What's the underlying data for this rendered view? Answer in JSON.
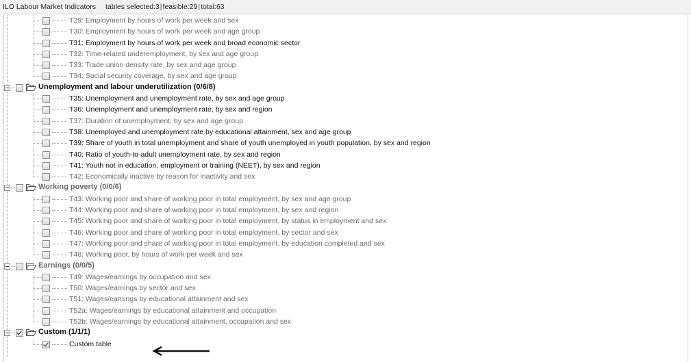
{
  "window": {
    "title": "ILO Labour Market Indicators",
    "status_prefix": "tables selected:3",
    "status_feasible": "feasible:29",
    "status_total": "total:63",
    "separator": "|"
  },
  "tree": {
    "rows": [
      {
        "kind": "leaf",
        "label": "T29: Employment by hours of work per week and sex",
        "enabled": false,
        "checked": false
      },
      {
        "kind": "leaf",
        "label": "T30: Employment by hours of work per week and age group",
        "enabled": false,
        "checked": false
      },
      {
        "kind": "leaf",
        "label": "T31: Employment by hours of work per week and broad economic sector",
        "enabled": true,
        "checked": false
      },
      {
        "kind": "leaf",
        "label": "T32: Time-related underemployment, by sex and age group",
        "enabled": false,
        "checked": false
      },
      {
        "kind": "leaf",
        "label": "T33: Trade union density rate, by sex and age group",
        "enabled": false,
        "checked": false
      },
      {
        "kind": "leaf",
        "label": "T34: Social security coverage, by sex and age group",
        "enabled": false,
        "checked": false
      },
      {
        "kind": "group",
        "label": "Unemployment and labour underutilization (0/6/8)",
        "enabled": true,
        "checked": false
      },
      {
        "kind": "leaf",
        "label": "T35: Unemployment and unemployment rate, by sex and age group",
        "enabled": true,
        "checked": false
      },
      {
        "kind": "leaf",
        "label": "T36: Unemployment and unemployment rate, by sex and region",
        "enabled": true,
        "checked": false
      },
      {
        "kind": "leaf",
        "label": "T37: Duration of unemployment, by sex and age group",
        "enabled": false,
        "checked": false
      },
      {
        "kind": "leaf",
        "label": "T38: Unemployed and unemployment rate by educational attainment, sex and age group",
        "enabled": true,
        "checked": false
      },
      {
        "kind": "leaf",
        "label": "T39: Share of youth in total unemployment and share of youth unemployed in youth population, by sex and region",
        "enabled": true,
        "checked": false
      },
      {
        "kind": "leaf",
        "label": "T40: Ratio of youth-to-adult unemployment rate, by sex and region",
        "enabled": true,
        "checked": false
      },
      {
        "kind": "leaf",
        "label": "T41: Youth not in education, employment or training (NEET), by sex and region",
        "enabled": true,
        "checked": false
      },
      {
        "kind": "leaf",
        "label": "T42: Economically inactive by reason for inactivity and sex",
        "enabled": false,
        "checked": false
      },
      {
        "kind": "group",
        "label": "Working poverty (0/0/6)",
        "enabled": false,
        "checked": false
      },
      {
        "kind": "leaf",
        "label": "T43: Working poor and share of working poor in total employment, by sex and age group",
        "enabled": false,
        "checked": false
      },
      {
        "kind": "leaf",
        "label": "T44: Working poor and share of working poor in total employment, by sex and region",
        "enabled": false,
        "checked": false
      },
      {
        "kind": "leaf",
        "label": "T45: Working poor and share of working poor in total employment, by status in employment and sex",
        "enabled": false,
        "checked": false
      },
      {
        "kind": "leaf",
        "label": "T46: Working poor and share of working poor in total employment, by sector and sex",
        "enabled": false,
        "checked": false
      },
      {
        "kind": "leaf",
        "label": "T47: Working poor and share of working poor in total employment, by education completed and sex",
        "enabled": false,
        "checked": false
      },
      {
        "kind": "leaf",
        "label": "T48: Working poor, by hours of work per week and sex",
        "enabled": false,
        "checked": false
      },
      {
        "kind": "group",
        "label": "Earnings (0/0/5)",
        "enabled": false,
        "checked": false
      },
      {
        "kind": "leaf",
        "label": "T49: Wages/earnings by occupation and sex",
        "enabled": false,
        "checked": false
      },
      {
        "kind": "leaf",
        "label": "T50: Wages/earnings by sector and sex",
        "enabled": false,
        "checked": false
      },
      {
        "kind": "leaf",
        "label": "T51: Wages/earnings by educational attainment and sex",
        "enabled": false,
        "checked": false
      },
      {
        "kind": "leaf",
        "label": "T52a: Wages/earnings by educational attainment and occupation",
        "enabled": false,
        "checked": false
      },
      {
        "kind": "leaf",
        "label": "T52b: Wages/earnings by educational attainment, occupation and sex",
        "enabled": false,
        "checked": false
      },
      {
        "kind": "group",
        "label": "Custom (1/1/1)",
        "enabled": true,
        "checked": true
      },
      {
        "kind": "leaf",
        "label": "Custom table",
        "enabled": true,
        "checked": true
      }
    ]
  }
}
